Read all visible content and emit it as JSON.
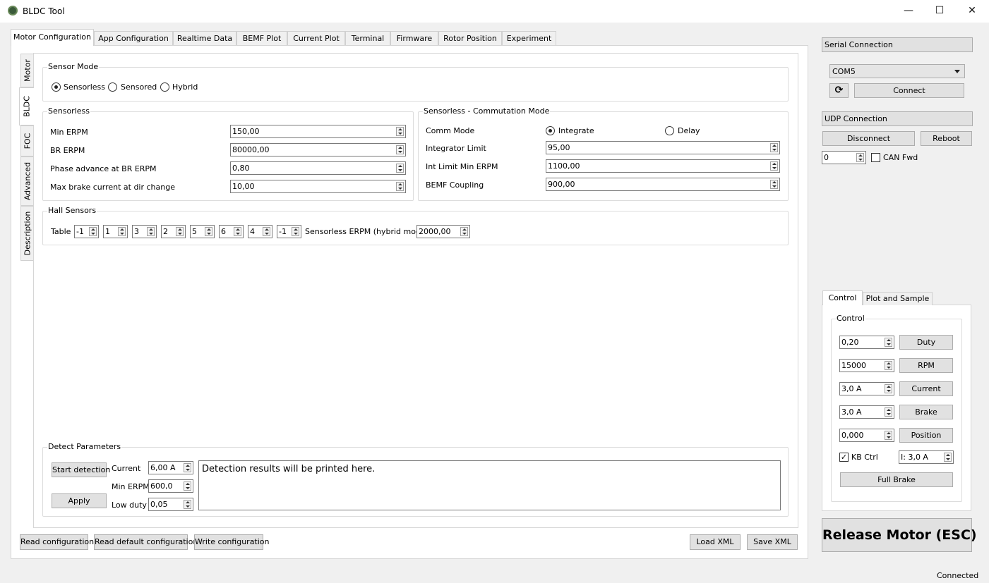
{
  "window": {
    "title": "BLDC Tool",
    "minimize": "—",
    "maximize": "☐",
    "close": "✕"
  },
  "main_tabs": [
    "Motor Configuration",
    "App Configuration",
    "Realtime Data",
    "BEMF Plot",
    "Current Plot",
    "Terminal",
    "Firmware",
    "Rotor Position",
    "Experiment"
  ],
  "side_tabs": [
    "Motor",
    "BLDC",
    "FOC",
    "Advanced",
    "Description"
  ],
  "sensor_mode": {
    "title": "Sensor Mode",
    "options": [
      "Sensorless",
      "Sensored",
      "Hybrid"
    ],
    "selected": "Sensorless"
  },
  "sensorless": {
    "title": "Sensorless",
    "rows": [
      {
        "label": "Min ERPM",
        "value": "150,00"
      },
      {
        "label": "BR ERPM",
        "value": "80000,00"
      },
      {
        "label": "Phase advance at BR ERPM",
        "value": "0,80"
      },
      {
        "label": "Max brake current at dir change",
        "value": "10,00"
      }
    ]
  },
  "commutation": {
    "title": "Sensorless - Commutation Mode",
    "comm_mode_label": "Comm Mode",
    "options": [
      "Integrate",
      "Delay"
    ],
    "selected": "Integrate",
    "rows": [
      {
        "label": "Integrator Limit",
        "value": "95,00"
      },
      {
        "label": "Int Limit Min ERPM",
        "value": "1100,00"
      },
      {
        "label": "BEMF Coupling",
        "value": "900,00"
      }
    ]
  },
  "hall": {
    "title": "Hall Sensors",
    "table_label": "Table",
    "table": [
      "-1",
      "1",
      "3",
      "2",
      "5",
      "6",
      "4",
      "-1"
    ],
    "erpm_label": "Sensorless ERPM (hybrid mode)",
    "erpm_value": "2000,00"
  },
  "detect": {
    "title": "Detect Parameters",
    "start": "Start detection",
    "apply": "Apply",
    "current_label": "Current",
    "current": "6,00 A",
    "min_erpm_label": "Min ERPM",
    "min_erpm": "600,0",
    "low_duty_label": "Low duty",
    "low_duty": "0,05",
    "results": "Detection results will be printed here."
  },
  "bottom": {
    "read": "Read configuration",
    "read_default": "Read default configuration",
    "write": "Write configuration",
    "load_xml": "Load XML",
    "save_xml": "Save XML"
  },
  "serial": {
    "title": "Serial Connection",
    "port": "COM5",
    "connect": "Connect"
  },
  "udp": {
    "title": "UDP Connection",
    "disconnect": "Disconnect",
    "reboot": "Reboot",
    "can_id": "0",
    "can_fwd": "CAN Fwd"
  },
  "control_tabs": [
    "Control",
    "Plot and Sample"
  ],
  "control": {
    "title": "Control",
    "rows": [
      {
        "value": "0,20",
        "button": "Duty"
      },
      {
        "value": "15000",
        "button": "RPM"
      },
      {
        "value": "3,0 A",
        "button": "Current"
      },
      {
        "value": "3,0 A",
        "button": "Brake"
      },
      {
        "value": "0,000",
        "button": "Position"
      }
    ],
    "kb_ctrl": "KB Ctrl",
    "kb_checked": true,
    "kb_value": "I: 3,0 A",
    "full_brake": "Full Brake"
  },
  "release": "Release Motor (ESC)",
  "status": "Connected"
}
